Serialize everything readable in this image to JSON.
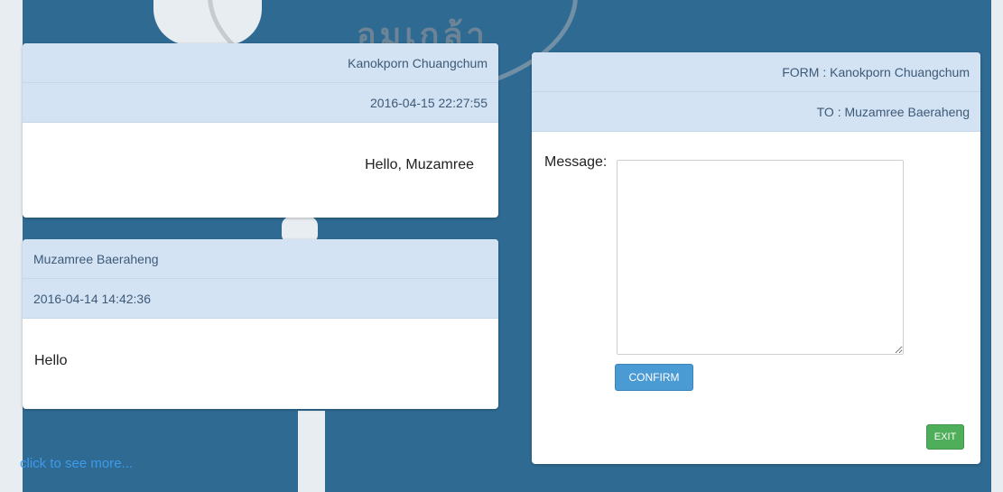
{
  "messages": [
    {
      "sender": "Kanokporn Chuangchum",
      "timestamp": "2016-04-15 22:27:55",
      "text": "Hello, Muzamree"
    },
    {
      "sender": "Muzamree Baeraheng",
      "timestamp": "2016-04-14 14:42:36",
      "text": "Hello"
    }
  ],
  "see_more": "click to see more...",
  "compose": {
    "from": "FORM : Kanokporn Chuangchum",
    "to": "TO : Muzamree Baeraheng",
    "message_label": "Message:",
    "message_value": "",
    "confirm_label": "CONFIRM",
    "exit_label": "EXIT"
  },
  "colors": {
    "background": "#2f6a93",
    "header": "#d3e3f3",
    "confirm": "#4a9ad4",
    "exit": "#4fae5a",
    "link": "#3d9be9"
  }
}
